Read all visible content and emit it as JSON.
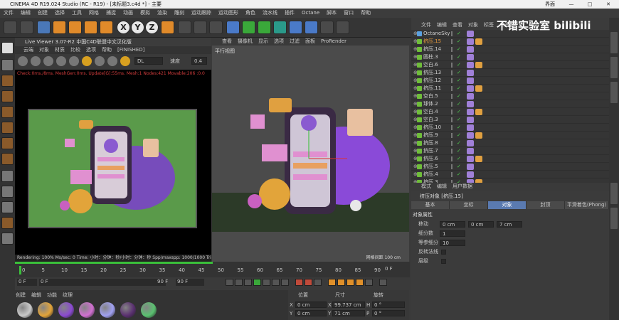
{
  "window": {
    "title": "CINEMA 4D R19.024 Studio (RC - R19) - [未标题3.c4d *] - 主要",
    "btn_min": "—",
    "btn_max": "□",
    "btn_close": "✕",
    "layout_label": "界面"
  },
  "menubar": [
    "文件",
    "编辑",
    "创建",
    "选择",
    "工具",
    "网格",
    "捕捉",
    "动画",
    "模拟",
    "渲染",
    "雕刻",
    "运动跟踪",
    "运动图形",
    "角色",
    "流水线",
    "插件",
    "Octane",
    "脚本",
    "窗口",
    "帮助"
  ],
  "toolbar": {
    "axis_x": "X",
    "axis_y": "Y",
    "axis_z": "Z"
  },
  "liveviewer": {
    "title": "Live Viewer 3.07-R2 中国C4D联盟中文汉化版",
    "menu": [
      "云端",
      "对象",
      "材质",
      "比较",
      "选项",
      "帮助",
      "[FINISHED]"
    ],
    "preset": "DL",
    "speed_label": "速度",
    "speed_value": "0.4",
    "status": "Check:0ms./8ms. MeshGen:0ms. Update[G]:55ms. Mesh:1 Nodes:421 Movable:206 :0.0",
    "bottom": "Rendering: 100%   Ms/sec: 0   Time: 小时：分钟：秒/小时：分钟：秒   Spp/maxspp: 1000/1000   Tri: 0/14"
  },
  "viewport": {
    "menu": [
      "查看",
      "摄像机",
      "显示",
      "选项",
      "过滤",
      "面板",
      "ProRender"
    ],
    "label": "平行视图",
    "grid_label": "网格间距：100 cm"
  },
  "object_manager": {
    "menu": [
      "文件",
      "编辑",
      "查看",
      "对象",
      "标签",
      "书签"
    ],
    "rows": [
      {
        "name": "OctaneSky",
        "sel": false
      },
      {
        "name": "挤压.15",
        "sel": true
      },
      {
        "name": "挤压.14",
        "sel": false
      },
      {
        "name": "圆柱.3",
        "sel": false
      },
      {
        "name": "空白.6",
        "sel": false
      },
      {
        "name": "挤压.13",
        "sel": false
      },
      {
        "name": "挤压.12",
        "sel": false
      },
      {
        "name": "挤压.11",
        "sel": false
      },
      {
        "name": "空白.5",
        "sel": false
      },
      {
        "name": "球体.2",
        "sel": false
      },
      {
        "name": "空白.4",
        "sel": false
      },
      {
        "name": "空白.3",
        "sel": false
      },
      {
        "name": "挤压.10",
        "sel": false
      },
      {
        "name": "挤压.9",
        "sel": false
      },
      {
        "name": "挤压.8",
        "sel": false
      },
      {
        "name": "挤压.7",
        "sel": false
      },
      {
        "name": "挤压.6",
        "sel": false
      },
      {
        "name": "挤压.5",
        "sel": false
      },
      {
        "name": "挤压.4",
        "sel": false
      },
      {
        "name": "挤压.3",
        "sel": false
      }
    ]
  },
  "attributes": {
    "menu": [
      "模式",
      "编辑",
      "用户数据"
    ],
    "object": "挤压对象 [挤压.15]",
    "tabs": [
      "基本",
      "坐标",
      "对象",
      "封顶",
      "平滑着色(Phong)"
    ],
    "active_tab": "对象",
    "section": "对象属性",
    "move_label": "移动",
    "move_x": "0 cm",
    "move_y": "0 cm",
    "move_z": "7 cm",
    "subdiv_label": "细分数",
    "subdiv_value": "1",
    "iso_label": "等参细分",
    "iso_value": "10",
    "flip_label": "反转法线",
    "layer_label": "层级"
  },
  "timeline": {
    "ticks": [
      "0",
      "5",
      "10",
      "15",
      "20",
      "25",
      "30",
      "35",
      "40",
      "45",
      "50",
      "55",
      "60",
      "65",
      "70",
      "75",
      "80",
      "85",
      "90"
    ],
    "frame": "0 F",
    "start": "0 F",
    "end": "90 F",
    "end2": "90 F",
    "current": "0 F"
  },
  "materials": {
    "menu": [
      "创建",
      "编辑",
      "功能",
      "纹理"
    ],
    "balls": [
      "#c9c9c9",
      "#e2a43a",
      "#8a4ad0",
      "#d070d0",
      "#a0a0f0",
      "#5a3070",
      "#5ac070"
    ]
  },
  "coords": {
    "h_pos": "位置",
    "h_size": "尺寸",
    "h_rot": "旋转",
    "x_label": "X",
    "x_pos": "0 cm",
    "x_size": "99.737 cm",
    "h_label": "H",
    "h_val": "0 °",
    "y_label": "Y",
    "y_pos": "0 cm",
    "y_size": "71 cm",
    "p_label": "P",
    "p_val": "0 °"
  },
  "watermark": "不错实验室 bilibili",
  "vp_bottom": "网格间距 100 cm"
}
